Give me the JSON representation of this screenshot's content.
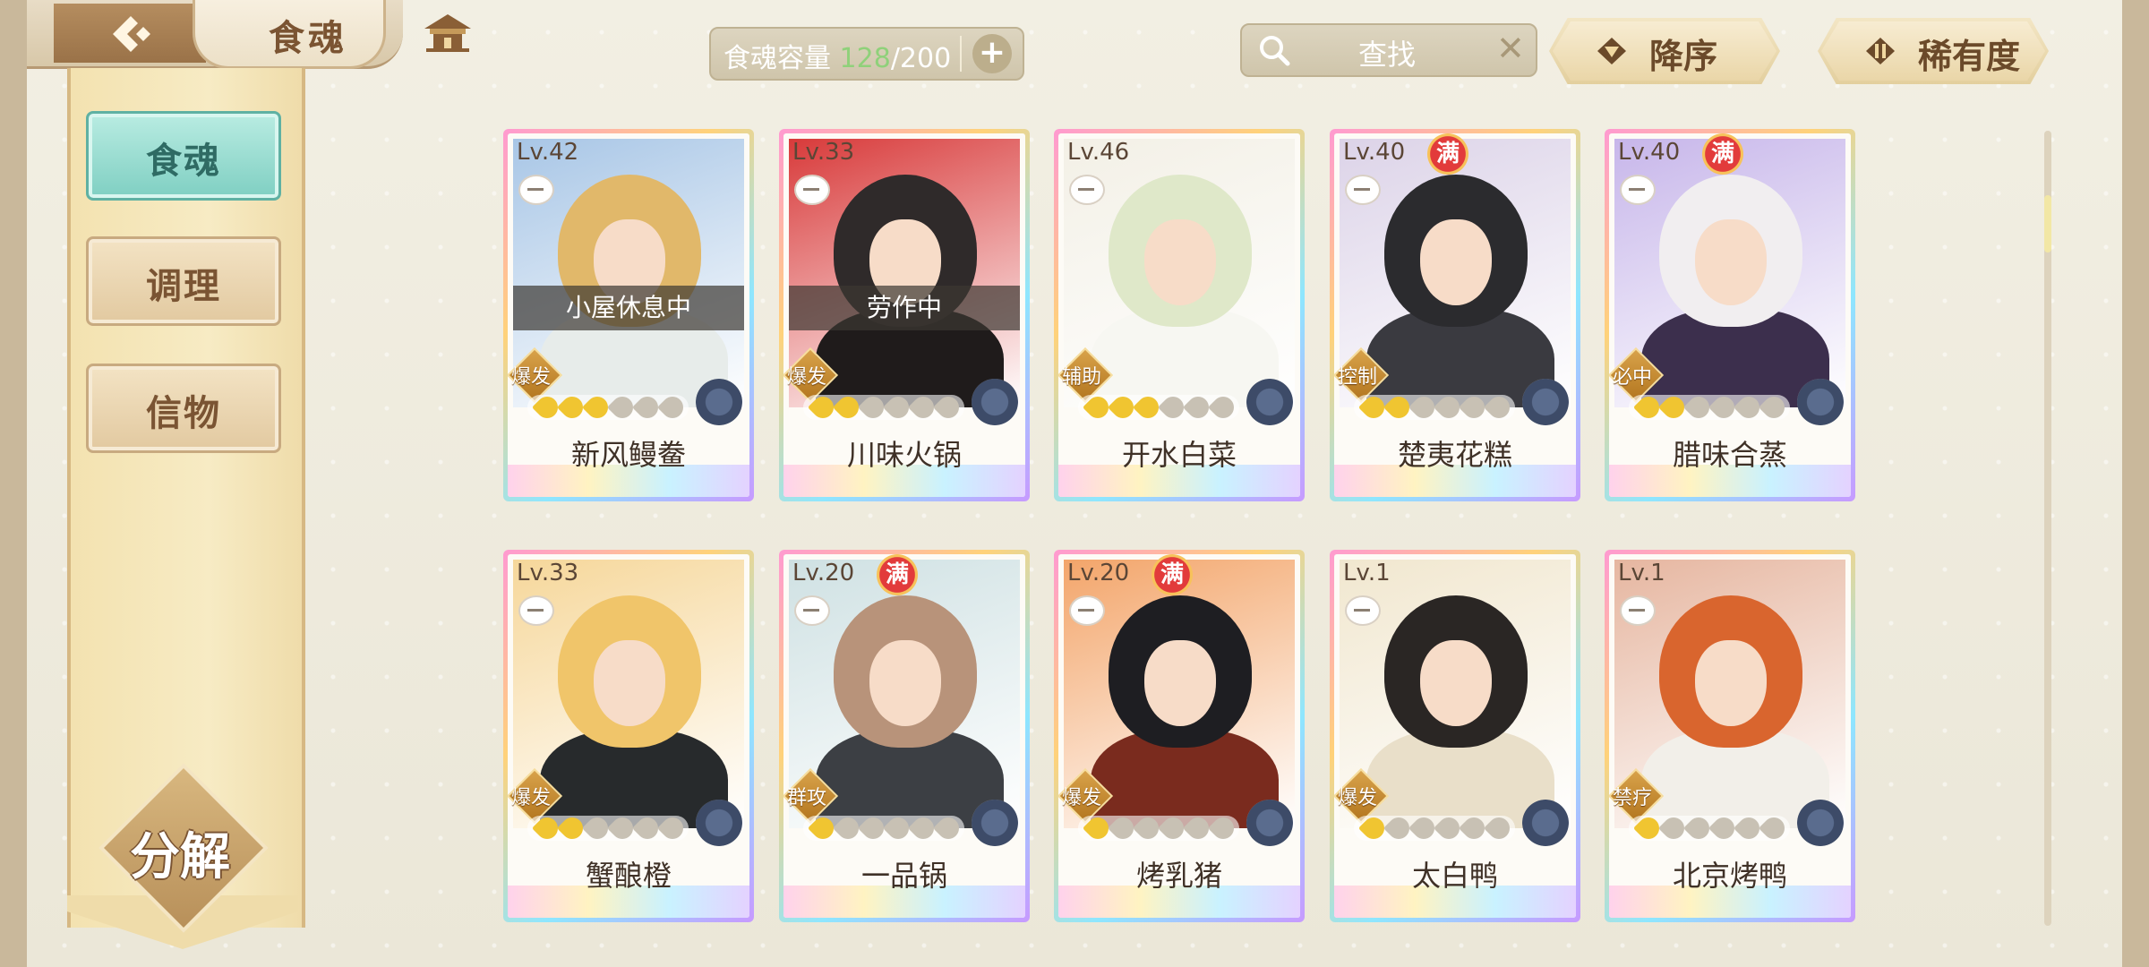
{
  "header": {
    "title": "食魂",
    "capacity_label": "食魂容量",
    "capacity_used": "128",
    "capacity_total": "/200",
    "capacity_add": "+",
    "search_placeholder": "查找",
    "search_clear": "✕",
    "sort_order_label": "降序",
    "sort_field_label": "稀有度"
  },
  "sidebar": {
    "items": [
      {
        "label": "食魂",
        "active": true
      },
      {
        "label": "调理",
        "active": false
      },
      {
        "label": "信物",
        "active": false
      }
    ],
    "decompose_label": "分解"
  },
  "cards": [
    {
      "name": "新风鳗鲞",
      "level": "Lv.42",
      "full": "",
      "status": "小屋休息中",
      "role": "爆发",
      "stars_on": 3,
      "colors": {
        "bg": "#a8c6e6",
        "hair": "#e1b86a",
        "body": "#e7ecea"
      }
    },
    {
      "name": "川味火锅",
      "level": "Lv.33",
      "full": "",
      "status": "劳作中",
      "role": "爆发",
      "stars_on": 2,
      "colors": {
        "bg": "#d83a3a",
        "hair": "#2f2a2a",
        "body": "#1f1b1b"
      }
    },
    {
      "name": "开水白菜",
      "level": "Lv.46",
      "full": "",
      "status": "",
      "role": "辅助",
      "stars_on": 3,
      "colors": {
        "bg": "#f3f0e6",
        "hair": "#dfe8c9",
        "body": "#f7f7f2"
      }
    },
    {
      "name": "楚夷花糕",
      "level": "Lv.40",
      "full": "满",
      "status": "",
      "role": "控制",
      "stars_on": 2,
      "colors": {
        "bg": "#dcd3e8",
        "hair": "#2b2b2e",
        "body": "#3a3a40"
      }
    },
    {
      "name": "腊味合蒸",
      "level": "Lv.40",
      "full": "满",
      "status": "",
      "role": "必中",
      "stars_on": 2,
      "colors": {
        "bg": "#c7b6ea",
        "hair": "#f1eef0",
        "body": "#3c2f4d"
      }
    },
    {
      "name": "蟹酿橙",
      "level": "Lv.33",
      "full": "",
      "status": "",
      "role": "爆发",
      "stars_on": 2,
      "colors": {
        "bg": "#f6d79a",
        "hair": "#f0c56a",
        "body": "#272a2c"
      }
    },
    {
      "name": "一品锅",
      "level": "Lv.20",
      "full": "满",
      "status": "",
      "role": "群攻",
      "stars_on": 1,
      "colors": {
        "bg": "#cfe1e3",
        "hair": "#b8937a",
        "body": "#3c3f44"
      }
    },
    {
      "name": "烤乳猪",
      "level": "Lv.20",
      "full": "满",
      "status": "",
      "role": "爆发",
      "stars_on": 1,
      "colors": {
        "bg": "#f3a56a",
        "hair": "#1e1e22",
        "body": "#7a2b1e"
      }
    },
    {
      "name": "太白鸭",
      "level": "Lv.1",
      "full": "",
      "status": "",
      "role": "爆发",
      "stars_on": 1,
      "colors": {
        "bg": "#f1e7cf",
        "hair": "#2a2624",
        "body": "#e9dfc9"
      }
    },
    {
      "name": "北京烤鸭",
      "level": "Lv.1",
      "full": "",
      "status": "",
      "role": "禁疗",
      "stars_on": 1,
      "colors": {
        "bg": "#e6b6a0",
        "hair": "#d9652e",
        "body": "#f2efe9"
      }
    }
  ]
}
